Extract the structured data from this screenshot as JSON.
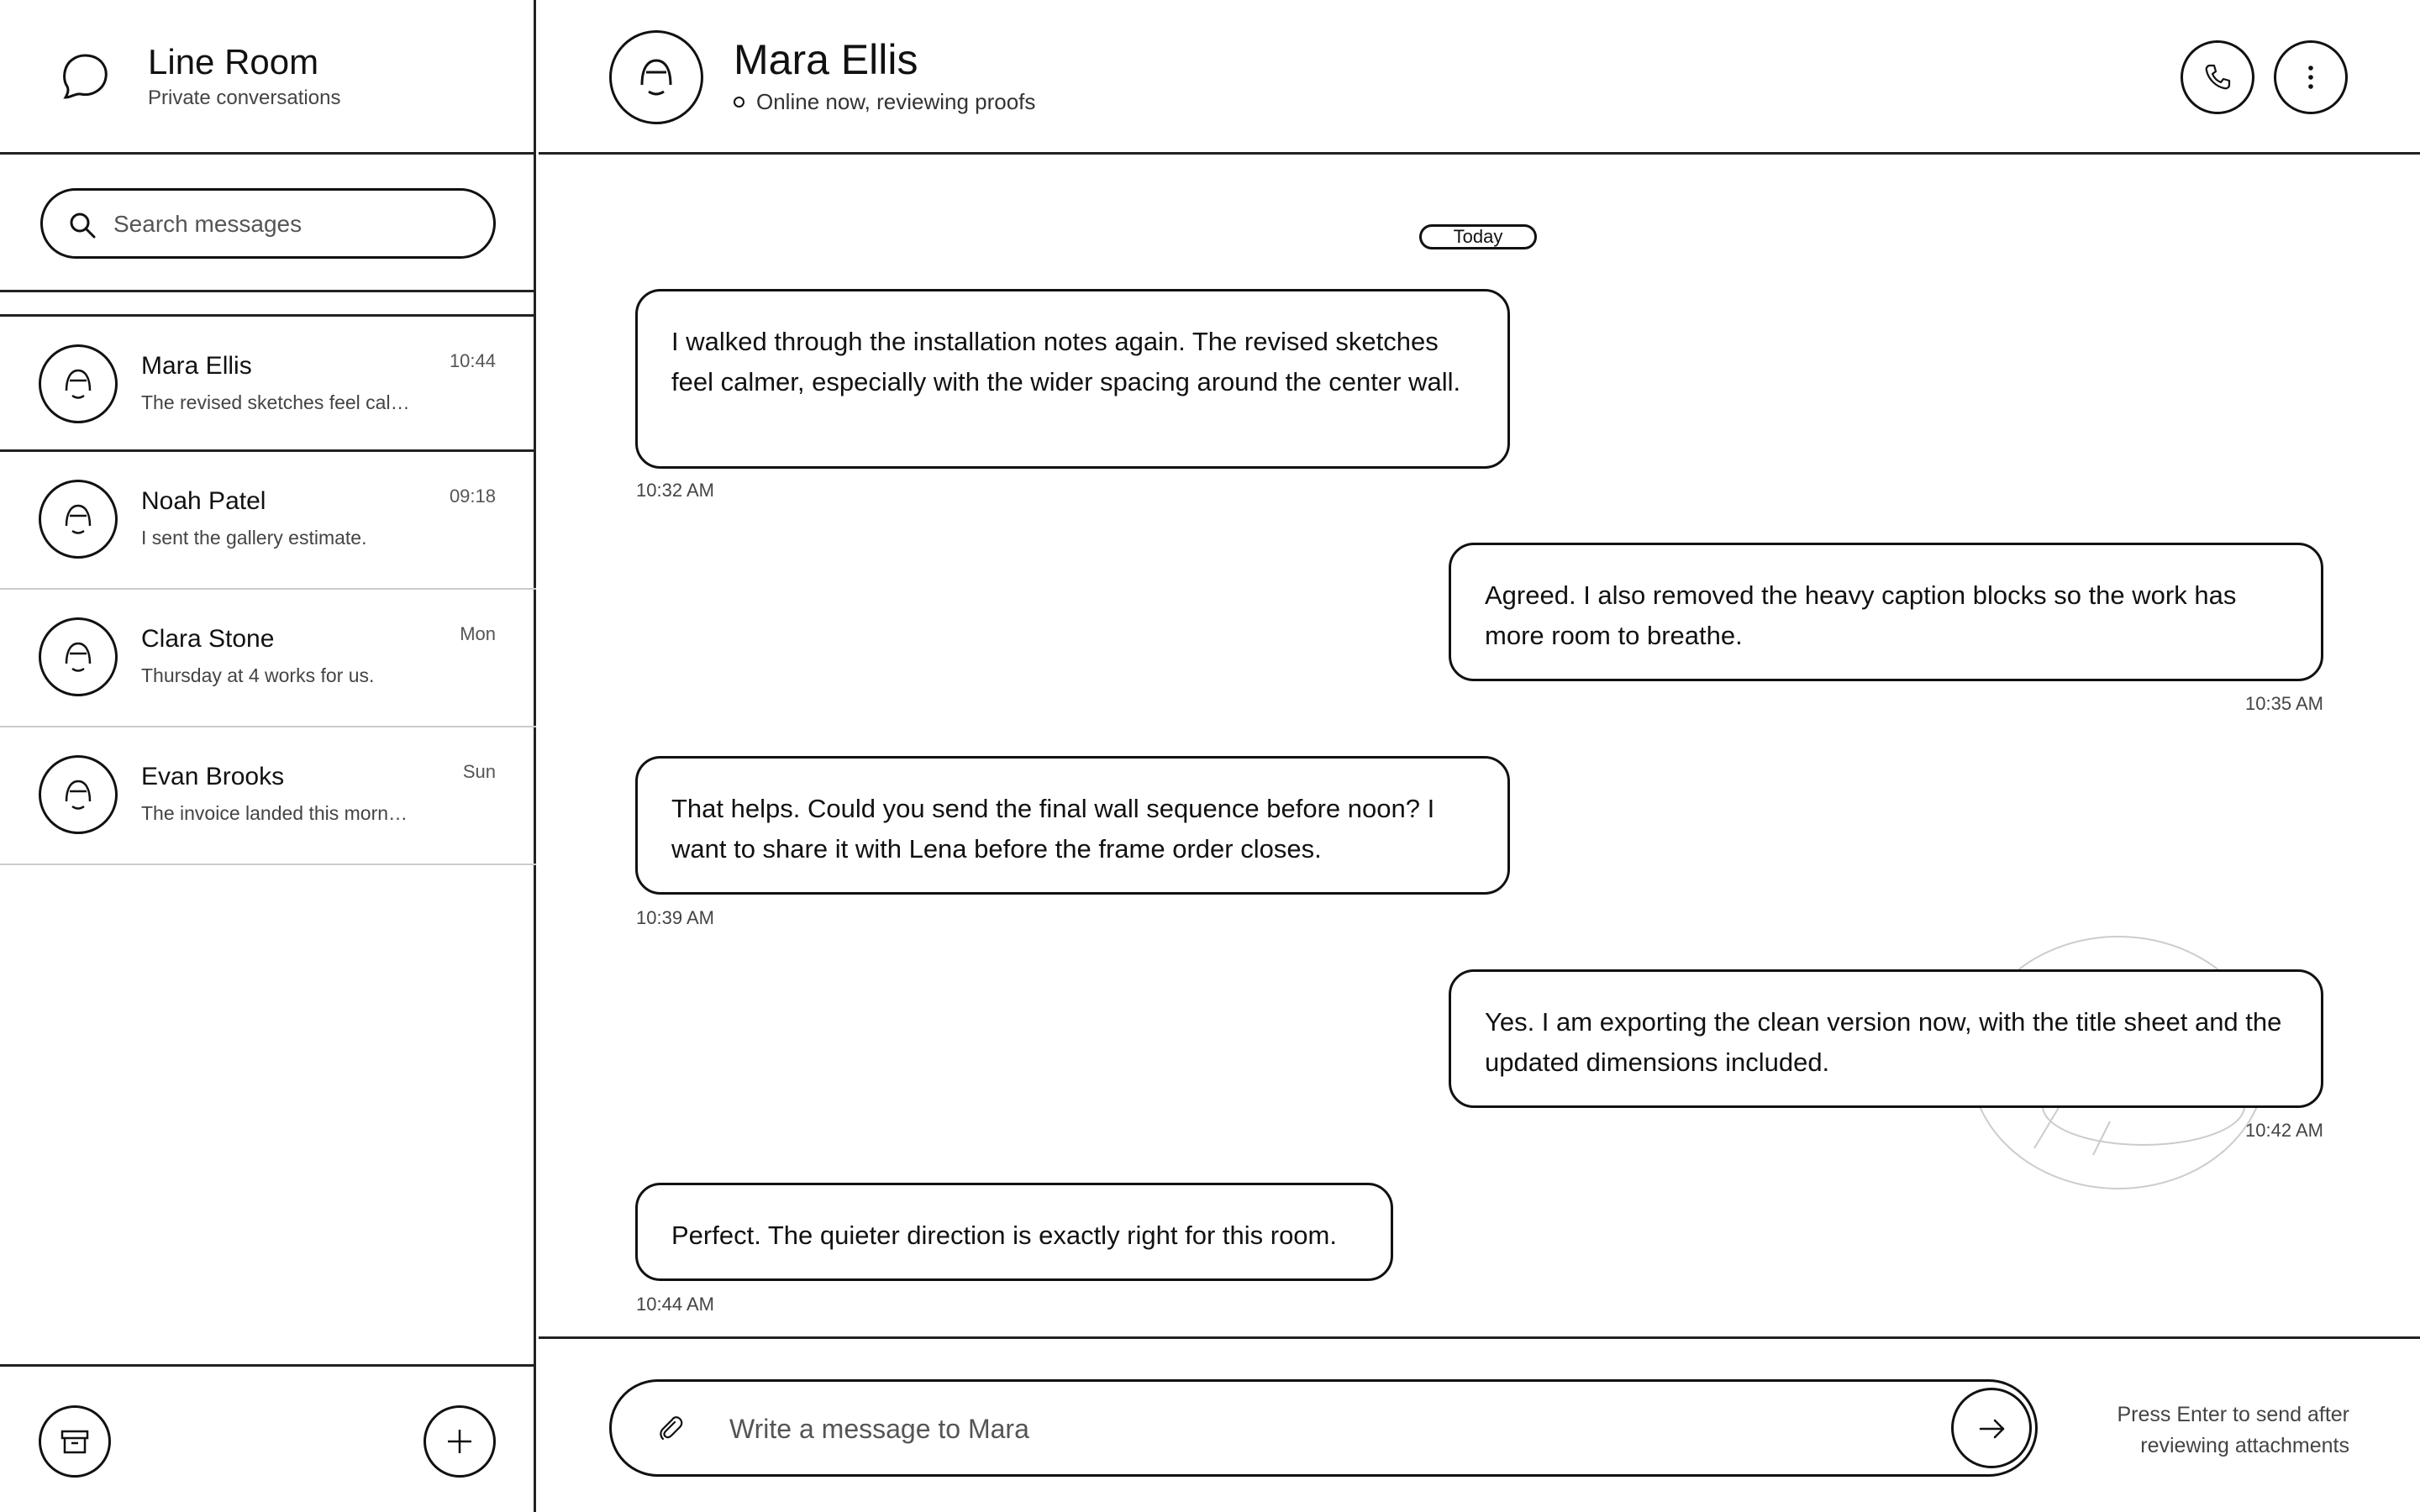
{
  "app": {
    "title": "Line Room",
    "subtitle": "Private conversations"
  },
  "search": {
    "placeholder": "Search messages"
  },
  "conversations": [
    {
      "name": "Mara Ellis",
      "preview": "The revised sketches feel cal…",
      "time": "10:44",
      "active": true
    },
    {
      "name": "Noah Patel",
      "preview": "I sent the gallery estimate.",
      "time": "09:18",
      "active": false
    },
    {
      "name": "Clara Stone",
      "preview": "Thursday at 4 works for us.",
      "time": "Mon",
      "active": false
    },
    {
      "name": "Evan Brooks",
      "preview": "The invoice landed this morn…",
      "time": "Sun",
      "active": false
    }
  ],
  "sidebar_actions": {
    "archive_icon": "archive-icon",
    "new_icon": "plus-icon"
  },
  "chat": {
    "contact_name": "Mara Ellis",
    "status": "Online now, reviewing proofs",
    "actions": [
      "phone-icon",
      "more-vertical-icon"
    ],
    "date_label": "Today",
    "messages": [
      {
        "direction": "incoming",
        "text": "I walked through the installation notes again. The revised sketches feel calmer, especially with the wider spacing around the center wall.",
        "time": "10:32 AM"
      },
      {
        "direction": "outgoing",
        "text": "Agreed. I also removed the heavy caption blocks so the work has more room to breathe.",
        "time": "10:35 AM"
      },
      {
        "direction": "incoming",
        "text": "That helps. Could you send the final wall sequence before noon? I want to share it with Lena before the frame order closes.",
        "time": "10:39 AM"
      },
      {
        "direction": "outgoing",
        "text": "Yes. I am exporting the clean version now, with the title sheet and the updated dimensions included.",
        "time": "10:42 AM"
      },
      {
        "direction": "incoming",
        "text": "Perfect. The quieter direction is exactly right for this room.",
        "time": "10:44 AM"
      }
    ]
  },
  "composer": {
    "placeholder": "Write a message to Mara",
    "hint": "Press Enter to send after reviewing attachments",
    "attach_icon": "paperclip-icon",
    "send_icon": "arrow-right-icon"
  }
}
